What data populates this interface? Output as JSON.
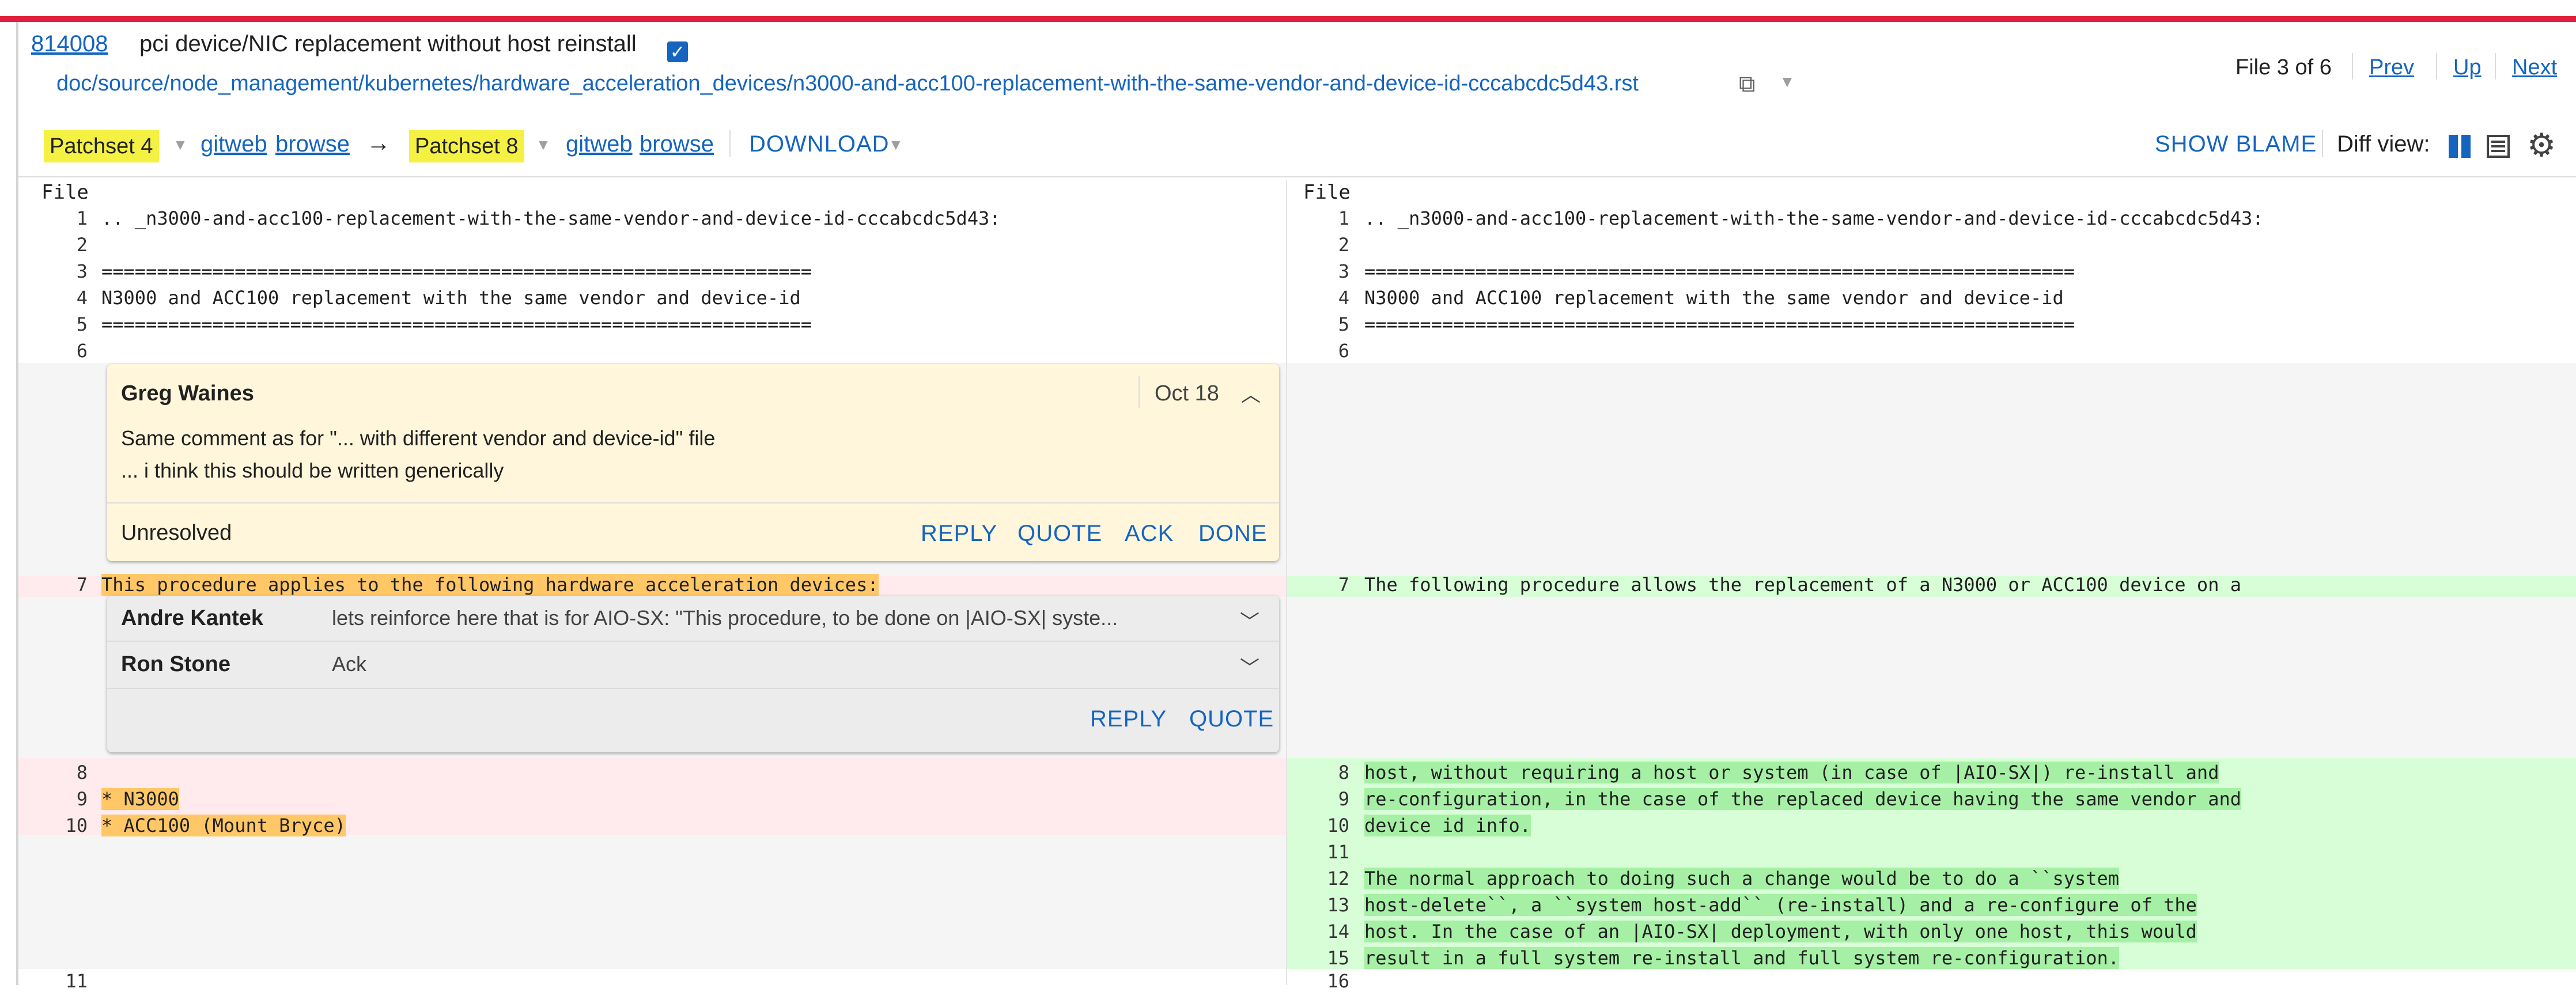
{
  "header": {
    "change_number": "814008",
    "subject": "pci device/NIC replacement without host reinstall",
    "checkbox": "✓",
    "file_path": "doc/source/node_management/kubernetes/hardware_acceleration_devices/n3000-and-acc100-replacement-with-the-same-vendor-and-device-id-cccabcdc5d43.rst",
    "copy_icon": "⧉",
    "file_info": "File 3 of 6",
    "prev": "Prev",
    "up": "Up",
    "next": "Next"
  },
  "patchset_bar": {
    "left_patchset": "Patchset 4",
    "left_gitweb": "gitweb",
    "left_browse": "browse",
    "arrow": "→",
    "right_patchset": "Patchset 8",
    "right_gitweb": "gitweb",
    "right_browse": "browse",
    "download": "DOWNLOAD",
    "dropdown_glyph": "▼",
    "show_blame": "SHOW BLAME",
    "diff_view": "Diff view:",
    "settings_glyph": "⚙"
  },
  "diff": {
    "file_label": "File",
    "left_lines": [
      {
        "n": "1",
        "text": ".. _n3000-and-acc100-replacement-with-the-same-vendor-and-device-id-cccabcdc5d43:"
      },
      {
        "n": "2",
        "text": ""
      },
      {
        "n": "3",
        "text": "================================================================"
      },
      {
        "n": "4",
        "text": "N3000 and ACC100 replacement with the same vendor and device-id"
      },
      {
        "n": "5",
        "text": "================================================================"
      },
      {
        "n": "6",
        "text": ""
      }
    ],
    "right_lines": [
      {
        "n": "1",
        "text": ".. _n3000-and-acc100-replacement-with-the-same-vendor-and-device-id-cccabcdc5d43:"
      },
      {
        "n": "2",
        "text": ""
      },
      {
        "n": "3",
        "text": "================================================================"
      },
      {
        "n": "4",
        "text": "N3000 and ACC100 replacement with the same vendor and device-id"
      },
      {
        "n": "5",
        "text": "================================================================"
      },
      {
        "n": "6",
        "text": ""
      }
    ],
    "left_line7": {
      "n": "7",
      "text": "This procedure applies to the following hardware acceleration devices:"
    },
    "right_line7": {
      "n": "7",
      "text": "The following procedure allows the replacement of a N3000 or ACC100 device on a"
    },
    "left_removed": [
      {
        "n": "8",
        "text": ""
      },
      {
        "n": "9",
        "text": "* N3000"
      },
      {
        "n": "10",
        "text": "* ACC100 (Mount Bryce)"
      }
    ],
    "right_added": [
      {
        "n": "8",
        "text": "host, without requiring a host or system (in case of |AIO-SX|) re-install and"
      },
      {
        "n": "9",
        "text": "re-configuration, in the case of the replaced device having the same vendor and"
      },
      {
        "n": "10",
        "text": "device id info."
      },
      {
        "n": "11",
        "text": ""
      },
      {
        "n": "12",
        "text": "The normal approach to doing such a change would be to do a ``system"
      },
      {
        "n": "13",
        "text": "host-delete``, a ``system host-add`` (re-install) and a re-configure of the"
      },
      {
        "n": "14",
        "text": "host. In the case of an |AIO-SX| deployment, with only one host, this would"
      },
      {
        "n": "15",
        "text": "result in a full system re-install and full system re-configuration."
      }
    ],
    "left_last_n": "11",
    "right_last_n": "16"
  },
  "comment1": {
    "author": "Greg Waines",
    "date": "Oct 18",
    "collapse_glyph": "︿",
    "line1": "Same comment as for \"... with different vendor and device-id\" file",
    "line2": "... i think this should be written generically",
    "status": "Unresolved",
    "reply": "REPLY",
    "quote": "QUOTE",
    "ack": "ACK",
    "done": "DONE"
  },
  "comment2": {
    "author1": "Andre Kantek",
    "text1": "lets reinforce here that is for AIO-SX: \"This procedure, to be done on |AIO-SX| syste...",
    "author2": "Ron Stone",
    "text2": "Ack",
    "expand_glyph": "﹀",
    "reply": "REPLY",
    "quote": "QUOTE"
  },
  "colors": {
    "link": "#1565c0",
    "removed_bg": "#ffebee",
    "removed_highlight": "#ffc766",
    "added_bg": "#d8fed8",
    "added_highlight": "#a6f0a6",
    "patchset_highlight": "#f5f142",
    "top_bar": "#e0203a"
  }
}
